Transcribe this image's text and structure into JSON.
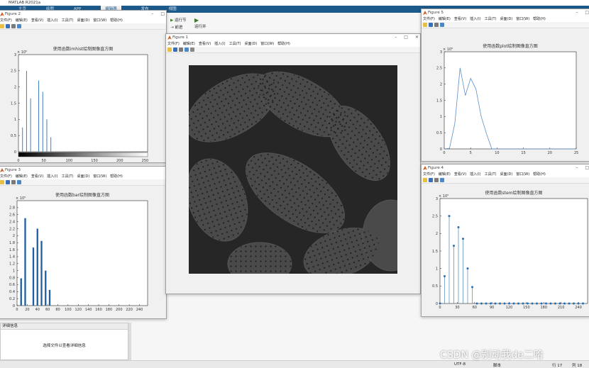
{
  "matlab": {
    "title": "MATLAB R2021a",
    "ribbon_tabs": [
      "主页",
      "绘图",
      "APP",
      "编辑器",
      "发布",
      "视图"
    ],
    "ribbon_selected": "编辑器",
    "editor_buttons": {
      "run_section": "运行节",
      "advance": "前进",
      "run_and_advance": "运行并"
    },
    "details_header": "详细信息",
    "details_text": "选择文件以查看详细信息",
    "status": {
      "encoding": "UTF-8",
      "script": "脚本",
      "line": "行 17",
      "col": "列 18"
    }
  },
  "menu_items": [
    "文件(F)",
    "编辑(E)",
    "查看(V)",
    "插入(I)",
    "工具(T)",
    "桌面(D)",
    "窗口(W)",
    "帮助(H)"
  ],
  "figures": {
    "fig1": {
      "title": "Figure 1"
    },
    "fig2": {
      "title": "Figure 2",
      "axes_title": "使用函数imhist绘制图像直方图",
      "exponent": "× 10⁵"
    },
    "fig3": {
      "title": "Figure 3",
      "axes_title": "使用函数bar绘制图像直方图",
      "exponent": "× 10⁵"
    },
    "fig4": {
      "title": "Figure 4",
      "axes_title": "使用函数stem绘制图像直方图",
      "exponent": "× 10⁵"
    },
    "fig5": {
      "title": "Figure 5",
      "axes_title": "使用函数plot绘制图像直方图",
      "exponent": "× 10⁵"
    }
  },
  "watermark": "CSDN @别动我de二哈",
  "chart_data": [
    {
      "type": "bar",
      "title": "使用函数imhist绘制图像直方图",
      "x": [
        8,
        16,
        24,
        32,
        40,
        48,
        56,
        64,
        72
      ],
      "values": [
        0.75,
        2.5,
        1.65,
        0.0,
        2.2,
        1.85,
        1.0,
        0.45,
        0.0
      ],
      "xlim": [
        0,
        255
      ],
      "ylim": [
        0,
        3
      ],
      "xticks": [
        0,
        50,
        100,
        150,
        200,
        250
      ],
      "yticks": [
        0,
        0.5,
        1,
        1.5,
        2,
        2.5,
        3
      ],
      "colors": {
        "bar": "#3f7fbf"
      }
    },
    {
      "type": "bar",
      "title": "使用函数bar绘制图像直方图",
      "x": [
        8,
        16,
        32,
        40,
        48,
        56,
        64,
        72
      ],
      "values": [
        0.78,
        2.5,
        1.66,
        2.2,
        1.85,
        1.0,
        0.45,
        0.0
      ],
      "xlim": [
        0,
        256
      ],
      "ylim": [
        0,
        3
      ],
      "xticks": [
        0,
        20,
        40,
        60,
        80,
        100,
        120,
        140,
        160,
        180,
        200,
        220,
        240
      ],
      "yticks": [
        0,
        0.2,
        0.4,
        0.6,
        0.8,
        1,
        1.2,
        1.4,
        1.6,
        1.8,
        2,
        2.2,
        2.4,
        2.6,
        2.8
      ],
      "colors": {
        "bar": "#1f5f9f"
      }
    },
    {
      "type": "scatter",
      "title": "使用函数stem绘制图像直方图",
      "x": [
        0,
        8,
        16,
        24,
        32,
        40,
        48,
        56,
        64,
        72,
        80,
        88,
        96,
        104,
        112,
        120,
        128,
        136,
        144,
        152,
        160,
        168,
        176,
        184,
        192,
        200,
        208,
        216,
        224,
        232,
        240,
        248
      ],
      "values": [
        0,
        0.78,
        2.5,
        1.65,
        2.18,
        1.85,
        1.0,
        0.47,
        0,
        0,
        0,
        0,
        0,
        0,
        0,
        0,
        0,
        0,
        0,
        0,
        0,
        0,
        0,
        0,
        0,
        0,
        0,
        0,
        0,
        0,
        0,
        0
      ],
      "xlim": [
        0,
        256
      ],
      "ylim": [
        0,
        3
      ],
      "xticks": [
        0,
        30,
        60,
        90,
        120,
        150,
        180,
        210,
        240
      ],
      "yticks": [
        0,
        0.5,
        1,
        1.5,
        2,
        2.5,
        3
      ],
      "colors": {
        "stem": "#2a6fb0"
      }
    },
    {
      "type": "line",
      "title": "使用函数plot绘制图像直方图",
      "x": [
        0,
        1,
        2,
        3,
        4,
        5,
        6,
        7,
        8,
        9,
        10,
        11,
        12,
        13,
        14,
        15,
        16,
        17,
        18,
        19,
        20,
        21,
        22,
        23,
        24,
        25
      ],
      "values": [
        0,
        0.02,
        0.78,
        2.5,
        1.65,
        2.18,
        1.85,
        1.0,
        0.47,
        0,
        0,
        0,
        0,
        0,
        0,
        0,
        0,
        0,
        0,
        0,
        0,
        0,
        0,
        0,
        0,
        0
      ],
      "xlim": [
        0,
        25
      ],
      "ylim": [
        0,
        3
      ],
      "xticks": [
        0,
        5,
        10,
        15,
        20,
        25
      ],
      "yticks": [
        0,
        0.5,
        1,
        1.5,
        2,
        2.5,
        3
      ],
      "colors": {
        "line": "#5b8ec9"
      }
    }
  ]
}
